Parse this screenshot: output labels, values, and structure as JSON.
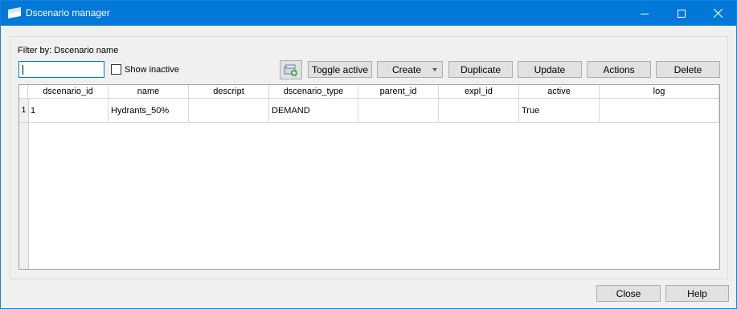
{
  "window": {
    "title": "Dscenario manager"
  },
  "filter": {
    "label": "Filter by: Dscenario name",
    "search_value": "",
    "show_inactive_label": "Show inactive",
    "show_inactive_checked": false
  },
  "toolbar": {
    "toggle_active": "Toggle active",
    "create": "Create",
    "duplicate": "Duplicate",
    "update": "Update",
    "actions": "Actions",
    "delete": "Delete"
  },
  "table": {
    "columns": [
      "dscenario_id",
      "name",
      "descript",
      "dscenario_type",
      "parent_id",
      "expl_id",
      "active",
      "log"
    ],
    "rows": [
      {
        "row_number": "1",
        "cells": [
          "1",
          "Hydrants_50%",
          "",
          "DEMAND",
          "",
          "",
          "True",
          ""
        ]
      }
    ]
  },
  "footer": {
    "close": "Close",
    "help": "Help"
  },
  "colors": {
    "titlebar": "#0078d7",
    "input_focus": "#0078d7"
  }
}
